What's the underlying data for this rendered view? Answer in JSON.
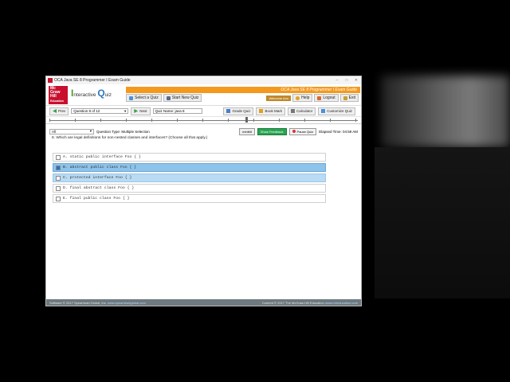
{
  "window": {
    "title": "OCA Java SE 8 Programmer I Exam Guide"
  },
  "brand": {
    "logo_lines": [
      "Mc",
      "Graw",
      "Hill",
      "Education"
    ],
    "iq_prefix": "I",
    "iq_mid": "nteractive ",
    "iq_q": "Q",
    "iq_suffix": "uiz",
    "banner": "OCA Java SE 8 Programmer I Exam Guide"
  },
  "header_nav": {
    "select_quiz": "Select a Quiz",
    "start_new_quiz": "Start New Quiz",
    "welcome": "Welcome Ann",
    "help": "Help",
    "logout": "Logout",
    "exit": "Exit"
  },
  "controls": {
    "prev": "Prev",
    "question_select": "Question 8 of 12",
    "next": "Next",
    "quiz_name": "Quiz Name: java 8",
    "grade_quiz": "Grade Quiz",
    "book_mark": "Book Mark",
    "calculator": "Calculator",
    "customize_quiz": "Customize Quiz"
  },
  "question": {
    "filter": "All",
    "type": "Question Type: Multiple Selection",
    "exhibit": "exhibit",
    "show_feedback": "Show Feedback",
    "pause_quiz": "Pause Quiz",
    "elapsed": "Elapsed Time: 04:59 AM",
    "text": "8. Which are legal definitions for non-nested classes and interfaces? (Choose all that apply.)",
    "answers": [
      {
        "label": "A. static public interface Foo { }",
        "checked": false,
        "state": "normal"
      },
      {
        "label": "B. abstract public class Foo { }",
        "checked": true,
        "state": "selected"
      },
      {
        "label": "C. protected interface Foo { }",
        "checked": false,
        "state": "hover"
      },
      {
        "label": "D. final abstract class Foo { }",
        "checked": false,
        "state": "normal"
      },
      {
        "label": "E. final public class Foo { }",
        "checked": false,
        "state": "normal"
      }
    ]
  },
  "footer": {
    "left_text": "Software © 2017 Spearhead Global, Inc.",
    "left_link": "www.spearheadglobal.com",
    "right_text": "Content © 2017 The McGraw-Hill Education",
    "right_link": "www.mheducation.com"
  },
  "colors": {
    "brand_red": "#c8102e",
    "banner_orange": "#f39a1e",
    "selection_blue": "#8ec3ea"
  }
}
